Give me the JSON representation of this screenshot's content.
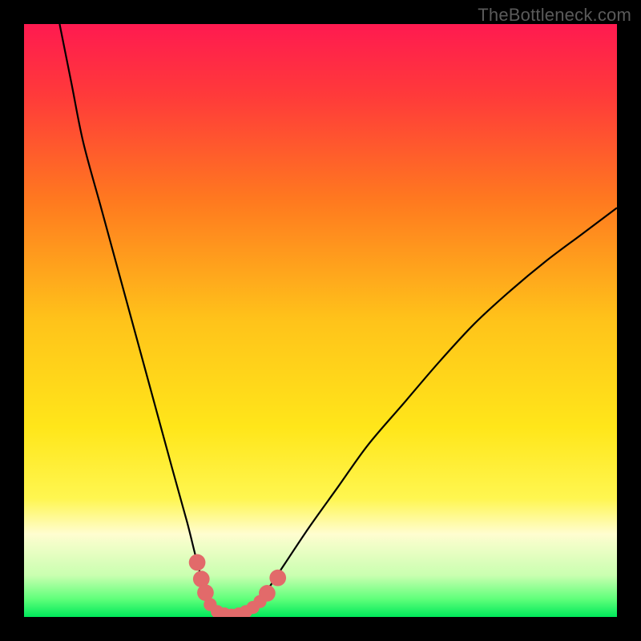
{
  "watermark": "TheBottleneck.com",
  "chart_data": {
    "type": "line",
    "title": "",
    "xlabel": "",
    "ylabel": "",
    "xlim": [
      0,
      100
    ],
    "ylim": [
      0,
      100
    ],
    "background_gradient": {
      "stops": [
        {
          "offset": 0.0,
          "color": "#ff1a50"
        },
        {
          "offset": 0.12,
          "color": "#ff3a3a"
        },
        {
          "offset": 0.3,
          "color": "#ff7a1f"
        },
        {
          "offset": 0.5,
          "color": "#ffc31a"
        },
        {
          "offset": 0.68,
          "color": "#ffe61a"
        },
        {
          "offset": 0.8,
          "color": "#fff650"
        },
        {
          "offset": 0.86,
          "color": "#fffdd0"
        },
        {
          "offset": 0.93,
          "color": "#c9ffb0"
        },
        {
          "offset": 0.97,
          "color": "#5fff7a"
        },
        {
          "offset": 1.0,
          "color": "#00e85a"
        }
      ]
    },
    "series": [
      {
        "name": "left-curve",
        "stroke": "#000000",
        "values": [
          {
            "x": 6.0,
            "y": 100.0
          },
          {
            "x": 8.0,
            "y": 90.0
          },
          {
            "x": 10.0,
            "y": 80.0
          },
          {
            "x": 13.0,
            "y": 69.0
          },
          {
            "x": 16.0,
            "y": 58.0
          },
          {
            "x": 19.0,
            "y": 47.0
          },
          {
            "x": 22.0,
            "y": 36.0
          },
          {
            "x": 25.0,
            "y": 25.0
          },
          {
            "x": 27.5,
            "y": 16.0
          },
          {
            "x": 29.0,
            "y": 10.0
          },
          {
            "x": 30.5,
            "y": 4.5
          },
          {
            "x": 31.5,
            "y": 2.0
          },
          {
            "x": 33.0,
            "y": 0.7
          },
          {
            "x": 35.0,
            "y": 0.3
          }
        ]
      },
      {
        "name": "right-curve",
        "stroke": "#000000",
        "values": [
          {
            "x": 35.0,
            "y": 0.3
          },
          {
            "x": 37.0,
            "y": 0.7
          },
          {
            "x": 39.0,
            "y": 2.0
          },
          {
            "x": 41.0,
            "y": 4.5
          },
          {
            "x": 44.0,
            "y": 9.0
          },
          {
            "x": 48.0,
            "y": 15.0
          },
          {
            "x": 53.0,
            "y": 22.0
          },
          {
            "x": 58.0,
            "y": 29.0
          },
          {
            "x": 64.0,
            "y": 36.0
          },
          {
            "x": 70.0,
            "y": 43.0
          },
          {
            "x": 76.0,
            "y": 49.5
          },
          {
            "x": 82.0,
            "y": 55.0
          },
          {
            "x": 88.0,
            "y": 60.0
          },
          {
            "x": 94.0,
            "y": 64.5
          },
          {
            "x": 100.0,
            "y": 69.0
          }
        ]
      }
    ],
    "markers": {
      "name": "highlight-points",
      "color": "#e26a6a",
      "radius_large": 1.4,
      "radius_small": 1.1,
      "points": [
        {
          "x": 29.2,
          "y": 9.2,
          "r": "large"
        },
        {
          "x": 29.9,
          "y": 6.4,
          "r": "large"
        },
        {
          "x": 30.6,
          "y": 4.1,
          "r": "large"
        },
        {
          "x": 31.4,
          "y": 2.1,
          "r": "small"
        },
        {
          "x": 32.6,
          "y": 0.9,
          "r": "small"
        },
        {
          "x": 33.8,
          "y": 0.5,
          "r": "small"
        },
        {
          "x": 35.0,
          "y": 0.3,
          "r": "small"
        },
        {
          "x": 36.2,
          "y": 0.5,
          "r": "small"
        },
        {
          "x": 37.4,
          "y": 0.9,
          "r": "small"
        },
        {
          "x": 38.6,
          "y": 1.6,
          "r": "small"
        },
        {
          "x": 39.8,
          "y": 2.6,
          "r": "small"
        },
        {
          "x": 41.0,
          "y": 4.0,
          "r": "large"
        },
        {
          "x": 42.8,
          "y": 6.6,
          "r": "large"
        }
      ]
    }
  }
}
